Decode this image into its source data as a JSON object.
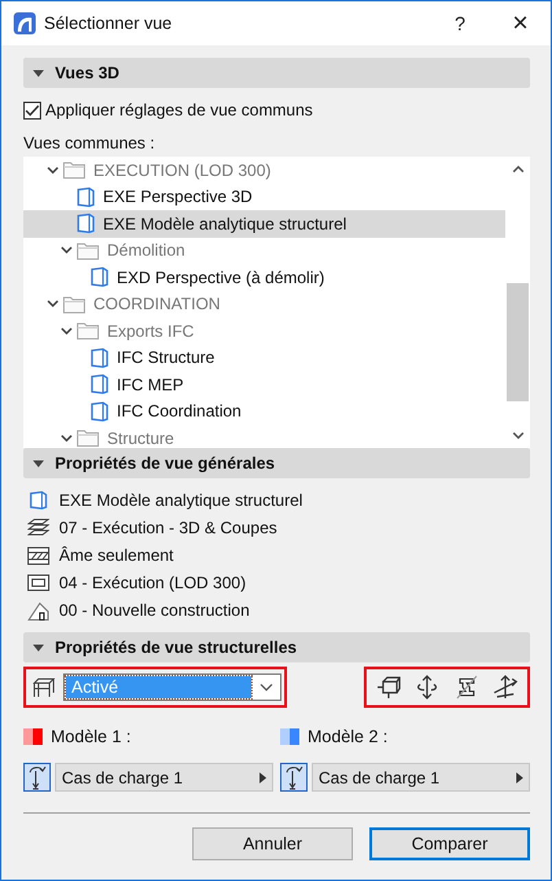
{
  "window": {
    "title": "Sélectionner vue",
    "help": "?",
    "close": "×"
  },
  "section_3d": {
    "title": "Vues 3D",
    "expanded": true,
    "apply_common": {
      "label": "Appliquer réglages de vue communs",
      "checked": true
    },
    "list_label": "Vues communes :"
  },
  "tree": [
    {
      "kind": "folder",
      "label": "EXECUTION (LOD 300)",
      "expanded": true,
      "selected": false,
      "children": [
        {
          "kind": "view",
          "label": "EXE Perspective 3D",
          "selected": false
        },
        {
          "kind": "view",
          "label": "EXE Modèle analytique structurel",
          "selected": true
        },
        {
          "kind": "folder",
          "label": "Démolition",
          "expanded": true,
          "selected": false,
          "children": [
            {
              "kind": "view",
              "label": "EXD Perspective (à démolir)",
              "selected": false
            }
          ]
        }
      ]
    },
    {
      "kind": "folder",
      "label": "COORDINATION",
      "expanded": true,
      "selected": false,
      "children": [
        {
          "kind": "folder",
          "label": "Exports IFC",
          "expanded": true,
          "selected": false,
          "children": [
            {
              "kind": "view",
              "label": "IFC Structure",
              "selected": false
            },
            {
              "kind": "view",
              "label": "IFC MEP",
              "selected": false
            },
            {
              "kind": "view",
              "label": "IFC Coordination",
              "selected": false
            }
          ]
        },
        {
          "kind": "folder",
          "label": "Structure",
          "expanded": true,
          "selected": false
        }
      ]
    }
  ],
  "section_general": {
    "title": "Propriétés de vue générales",
    "expanded": true,
    "properties": [
      {
        "kind": "view",
        "text": "EXE Modèle analytique structurel"
      },
      {
        "kind": "layers",
        "text": "07 - Exécution - 3D & Coupes"
      },
      {
        "kind": "fill",
        "text": "Âme seulement"
      },
      {
        "kind": "model",
        "text": "04 - Exécution (LOD 300)"
      },
      {
        "kind": "renovation",
        "text": "00 - Nouvelle construction"
      }
    ]
  },
  "section_structural": {
    "title": "Propriétés de vue structurelles",
    "expanded": true,
    "mode": {
      "value": "Activé"
    },
    "models": [
      {
        "label": "Modèle 1 :",
        "color": "#ff0000",
        "load_case": "Cas de charge 1"
      },
      {
        "label": "Modèle 2 :",
        "color": "#3a86ff",
        "load_case": "Cas de charge 1"
      }
    ]
  },
  "buttons": [
    {
      "label": "Annuler",
      "default": false
    },
    {
      "label": "Comparer",
      "default": true
    }
  ]
}
